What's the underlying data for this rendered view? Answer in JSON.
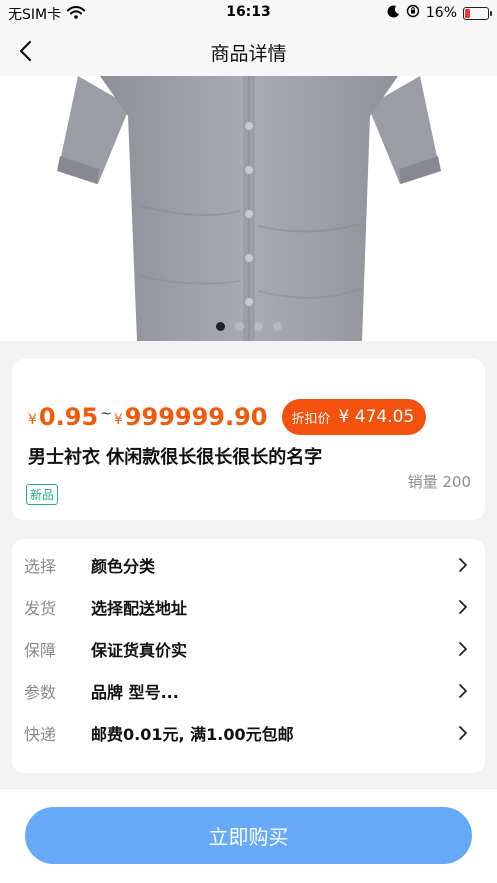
{
  "status_bar": {
    "carrier": "无SIM卡",
    "time": "16:13",
    "battery": "16%"
  },
  "nav": {
    "title": "商品详情"
  },
  "carousel": {
    "page_count": 4,
    "active_index": 0
  },
  "product": {
    "currency": "¥",
    "price_low": "0.95",
    "price_separator": "~",
    "price_high": "999999.90",
    "discount_label": "折扣价",
    "discount_price": "¥ 474.05",
    "name": "男士衬衣 休闲款很长很长很长的名字",
    "tag": "新品",
    "sales": "销量 200"
  },
  "options": [
    {
      "label": "选择",
      "value": "颜色分类"
    },
    {
      "label": "发货",
      "value": "选择配送地址"
    },
    {
      "label": "保障",
      "value": "保证货真价实"
    },
    {
      "label": "参数",
      "value": "品牌 型号..."
    },
    {
      "label": "快递",
      "value": "邮费0.01元, 满1.00元包邮"
    }
  ],
  "bottom": {
    "buy_label": "立即购买"
  },
  "colors": {
    "accent_orange": "#f15a0c",
    "button_blue": "#66a9f7",
    "tag_green": "#1fb37a"
  }
}
